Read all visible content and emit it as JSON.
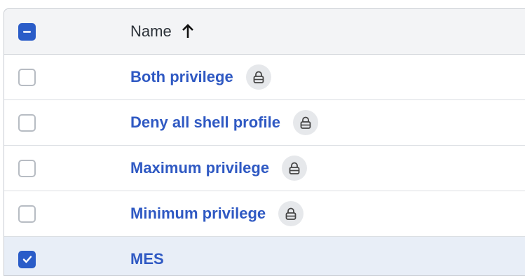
{
  "header": {
    "name_label": "Name",
    "sort_icon": "arrow-up-icon"
  },
  "rows": [
    {
      "name": "Both privilege",
      "locked": true,
      "checked": false
    },
    {
      "name": "Deny all shell profile",
      "locked": true,
      "checked": false
    },
    {
      "name": "Maximum privilege",
      "locked": true,
      "checked": false
    },
    {
      "name": "Minimum privilege",
      "locked": true,
      "checked": false
    },
    {
      "name": "MES",
      "locked": false,
      "checked": true
    }
  ],
  "colors": {
    "accent": "#2a5cc8",
    "link": "#2f59c3",
    "selected_row": "#e8eef7",
    "header_bg": "#f3f4f6"
  }
}
